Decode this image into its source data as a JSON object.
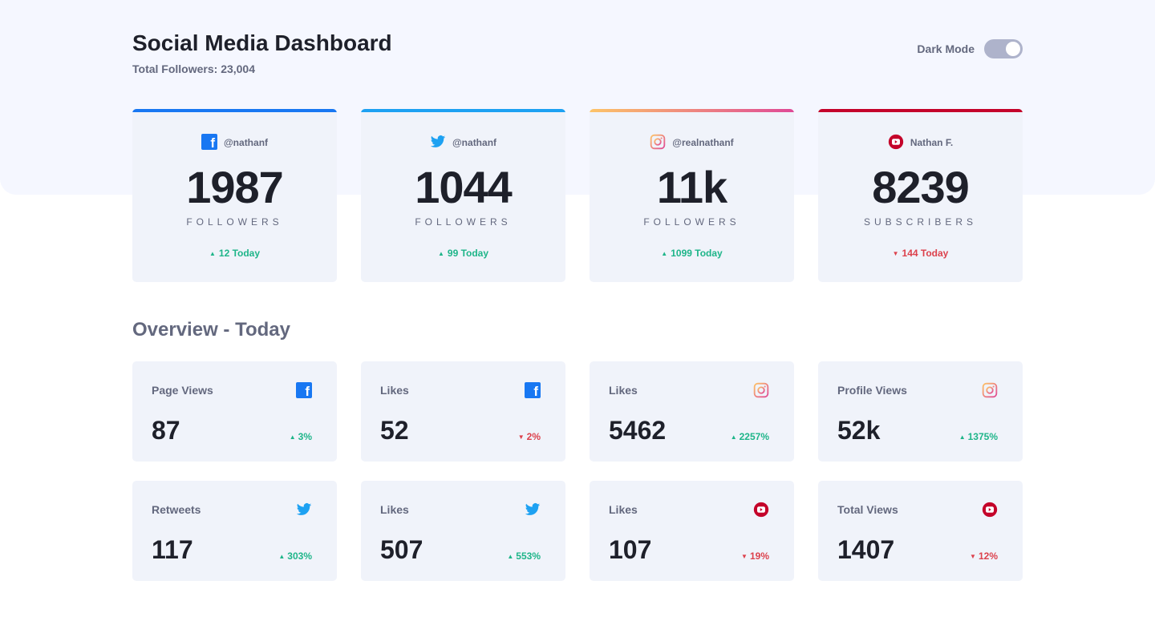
{
  "header": {
    "title": "Social Media Dashboard",
    "subtitle": "Total Followers: 23,004",
    "dark_mode_label": "Dark Mode"
  },
  "colors": {
    "facebook": "#1877f2",
    "twitter": "#1da1f2",
    "instagram_from": "#fdc468",
    "instagram_to": "#df4996",
    "youtube": "#c4032a",
    "up": "#1eb589",
    "down": "#dc414c"
  },
  "cards": [
    {
      "platform": "facebook",
      "icon": "facebook-icon",
      "handle": "@nathanf",
      "count": "1987",
      "label": "FOLLOWERS",
      "change": "12 Today",
      "trend": "up"
    },
    {
      "platform": "twitter",
      "icon": "twitter-icon",
      "handle": "@nathanf",
      "count": "1044",
      "label": "FOLLOWERS",
      "change": "99 Today",
      "trend": "up"
    },
    {
      "platform": "instagram",
      "icon": "instagram-icon",
      "handle": "@realnathanf",
      "count": "11k",
      "label": "FOLLOWERS",
      "change": "1099 Today",
      "trend": "up"
    },
    {
      "platform": "youtube",
      "icon": "youtube-icon",
      "handle": "Nathan F.",
      "count": "8239",
      "label": "SUBSCRIBERS",
      "change": "144 Today",
      "trend": "down"
    }
  ],
  "overview": {
    "title": "Overview - Today",
    "items": [
      {
        "label": "Page Views",
        "icon": "facebook-icon",
        "value": "87",
        "change": "3%",
        "trend": "up"
      },
      {
        "label": "Likes",
        "icon": "facebook-icon",
        "value": "52",
        "change": "2%",
        "trend": "down"
      },
      {
        "label": "Likes",
        "icon": "instagram-icon",
        "value": "5462",
        "change": "2257%",
        "trend": "up"
      },
      {
        "label": "Profile Views",
        "icon": "instagram-icon",
        "value": "52k",
        "change": "1375%",
        "trend": "up"
      },
      {
        "label": "Retweets",
        "icon": "twitter-icon",
        "value": "117",
        "change": "303%",
        "trend": "up"
      },
      {
        "label": "Likes",
        "icon": "twitter-icon",
        "value": "507",
        "change": "553%",
        "trend": "up"
      },
      {
        "label": "Likes",
        "icon": "youtube-icon",
        "value": "107",
        "change": "19%",
        "trend": "down"
      },
      {
        "label": "Total Views",
        "icon": "youtube-icon",
        "value": "1407",
        "change": "12%",
        "trend": "down"
      }
    ]
  }
}
